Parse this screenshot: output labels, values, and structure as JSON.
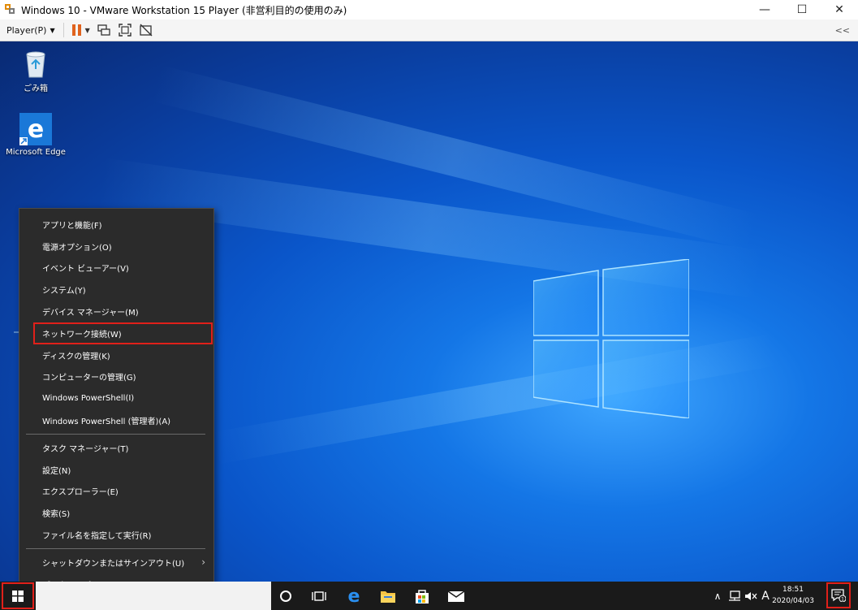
{
  "window": {
    "title": "Windows 10 - VMware Workstation 15 Player (非営利目的の使用のみ)",
    "minimize": "—",
    "maximize": "☐",
    "close": "✕"
  },
  "toolbar": {
    "player_menu": "Player(P)",
    "collapse": "<<"
  },
  "desktop": {
    "icons": [
      {
        "label": "ごみ箱",
        "icon": "recycle-bin-icon"
      },
      {
        "label": "Microsoft Edge",
        "icon": "edge-icon"
      }
    ]
  },
  "context_menu": {
    "items": [
      "アプリと機能(F)",
      "電源オプション(O)",
      "イベント ビューアー(V)",
      "システム(Y)",
      "デバイス マネージャー(M)",
      "ネットワーク接続(W)",
      "ディスクの管理(K)",
      "コンピューターの管理(G)",
      "Windows PowerShell(I)",
      "Windows PowerShell (管理者)(A)",
      "タスク マネージャー(T)",
      "設定(N)",
      "エクスプローラー(E)",
      "検索(S)",
      "ファイル名を指定して実行(R)",
      "シャットダウンまたはサインアウト(U)",
      "デスクトップ(D)"
    ],
    "highlighted_index": 5
  },
  "taskbar": {
    "ime": "A",
    "clock_time": "18:51",
    "clock_date": "2020/04/03",
    "notification_count": "1"
  },
  "colors": {
    "highlight_border": "#e0201a",
    "menu_bg": "#2b2b2b",
    "taskbar_bg": "#1a1a1a"
  }
}
